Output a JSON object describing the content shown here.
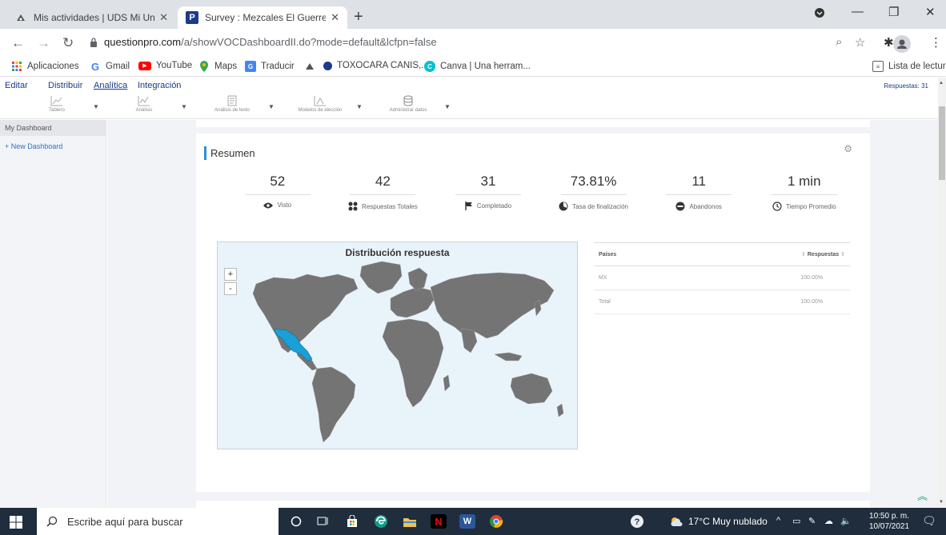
{
  "browser": {
    "tabs": [
      {
        "title": "Mis actividades | UDS Mi Univers",
        "close": "✕"
      },
      {
        "title": "Survey : Mezcales El Guerrerense",
        "close": "✕"
      }
    ],
    "url_host": "questionpro.com",
    "url_path": "/a/showVOCDashboardII.do?mode=default&lcfpn=false",
    "bookmarks": [
      "Aplicaciones",
      "Gmail",
      "YouTube",
      "Maps",
      "Traducir",
      "TOXOCARA CANIS,...",
      "Canva | Una herram..."
    ],
    "reading_list": "Lista de lectura"
  },
  "app": {
    "nav": [
      "Editar",
      "Distribuir",
      "Analítica",
      "Integración"
    ],
    "responses_label": "Respuestas: 31",
    "subnav": [
      "Tablero",
      "Análisis",
      "Análisis de texto",
      "Modelos de elección",
      "Administrar datos"
    ]
  },
  "sidebar": {
    "selected": "My Dashboard",
    "new_dashboard": "+ New Dashboard"
  },
  "summary": {
    "title": "Resumen",
    "stats": [
      {
        "value": "52",
        "label": "Visto",
        "icon": "eye-icon"
      },
      {
        "value": "42",
        "label": "Respuestas Totales",
        "icon": "dots-icon"
      },
      {
        "value": "31",
        "label": "Completado",
        "icon": "flag-icon"
      },
      {
        "value": "73.81%",
        "label": "Tasa de finalización",
        "icon": "gauge-icon"
      },
      {
        "value": "11",
        "label": "Abandonos",
        "icon": "minus-circle-icon"
      },
      {
        "value": "1 min",
        "label": "Tiempo Promedio",
        "icon": "clock-icon"
      }
    ]
  },
  "map": {
    "title": "Distribución respuesta",
    "zoom_in": "+",
    "zoom_out": "-",
    "land_color": "#747474",
    "highlight_color": "#1aa0d8",
    "water_color": "#e9f4fa"
  },
  "table": {
    "col_country": "Países",
    "col_responses": "Respuestas",
    "rows": [
      {
        "country": "MX",
        "value": "100.00%"
      },
      {
        "country": "Total",
        "value": "100.00%"
      }
    ]
  },
  "taskbar": {
    "search_placeholder": "Escribe aquí para buscar",
    "weather": "17°C  Muy nublado",
    "time": "10:50 p. m.",
    "date": "10/07/2021"
  }
}
